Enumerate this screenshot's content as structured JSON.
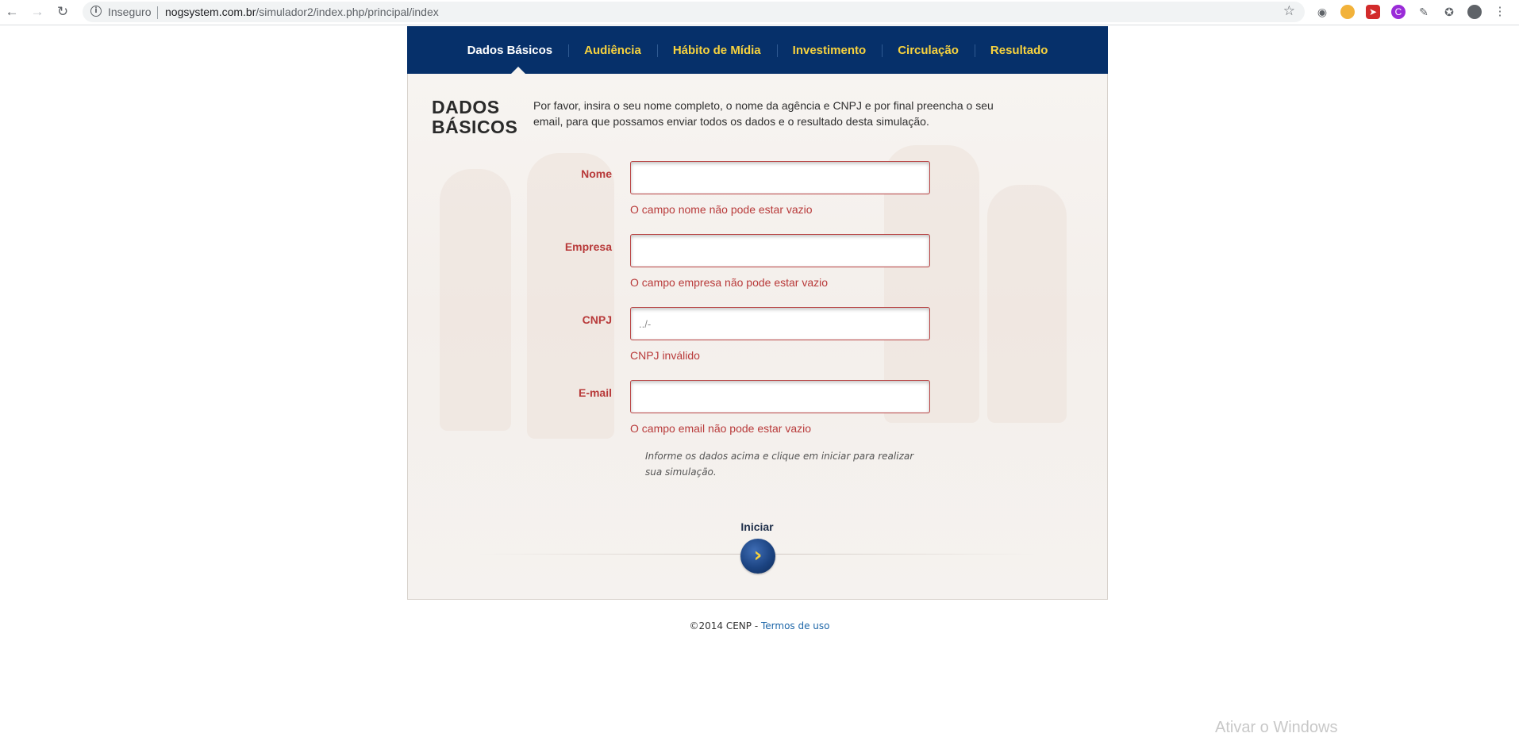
{
  "browser": {
    "security_label": "Inseguro",
    "url_host": "nogsystem.com.br",
    "url_path": "/simulador2/index.php/principal/index"
  },
  "nav": {
    "items": [
      {
        "label": "Dados Básicos",
        "active": true
      },
      {
        "label": "Audiência",
        "active": false
      },
      {
        "label": "Hábito de Mídia",
        "active": false
      },
      {
        "label": "Investimento",
        "active": false
      },
      {
        "label": "Circulação",
        "active": false
      },
      {
        "label": "Resultado",
        "active": false
      }
    ]
  },
  "section": {
    "title_line1": "DADOS",
    "title_line2": "BÁSICOS",
    "intro": "Por favor, insira o seu nome completo, o nome da agência e CNPJ e por final preencha o seu email, para que possamos enviar todos os dados e o resultado desta simulação."
  },
  "form": {
    "nome": {
      "label": "Nome",
      "value": "",
      "error": "O campo nome não pode estar vazio"
    },
    "empresa": {
      "label": "Empresa",
      "value": "",
      "error": "O campo empresa não pode estar vazio"
    },
    "cnpj": {
      "label": "CNPJ",
      "value": "../-",
      "error": "CNPJ inválido"
    },
    "email": {
      "label": "E-mail",
      "value": "",
      "error": "O campo email não pode estar vazio"
    },
    "hint": "Informe os dados acima e clique em iniciar para realizar sua simulação.",
    "submit_label": "Iniciar"
  },
  "footer": {
    "copyright": "©2014 CENP - ",
    "terms_link": "Termos de uso"
  },
  "os_watermark": "Ativar o Windows",
  "colors": {
    "navbar": "#06306a",
    "nav_link": "#f7d23e",
    "error": "#b83a3a"
  }
}
